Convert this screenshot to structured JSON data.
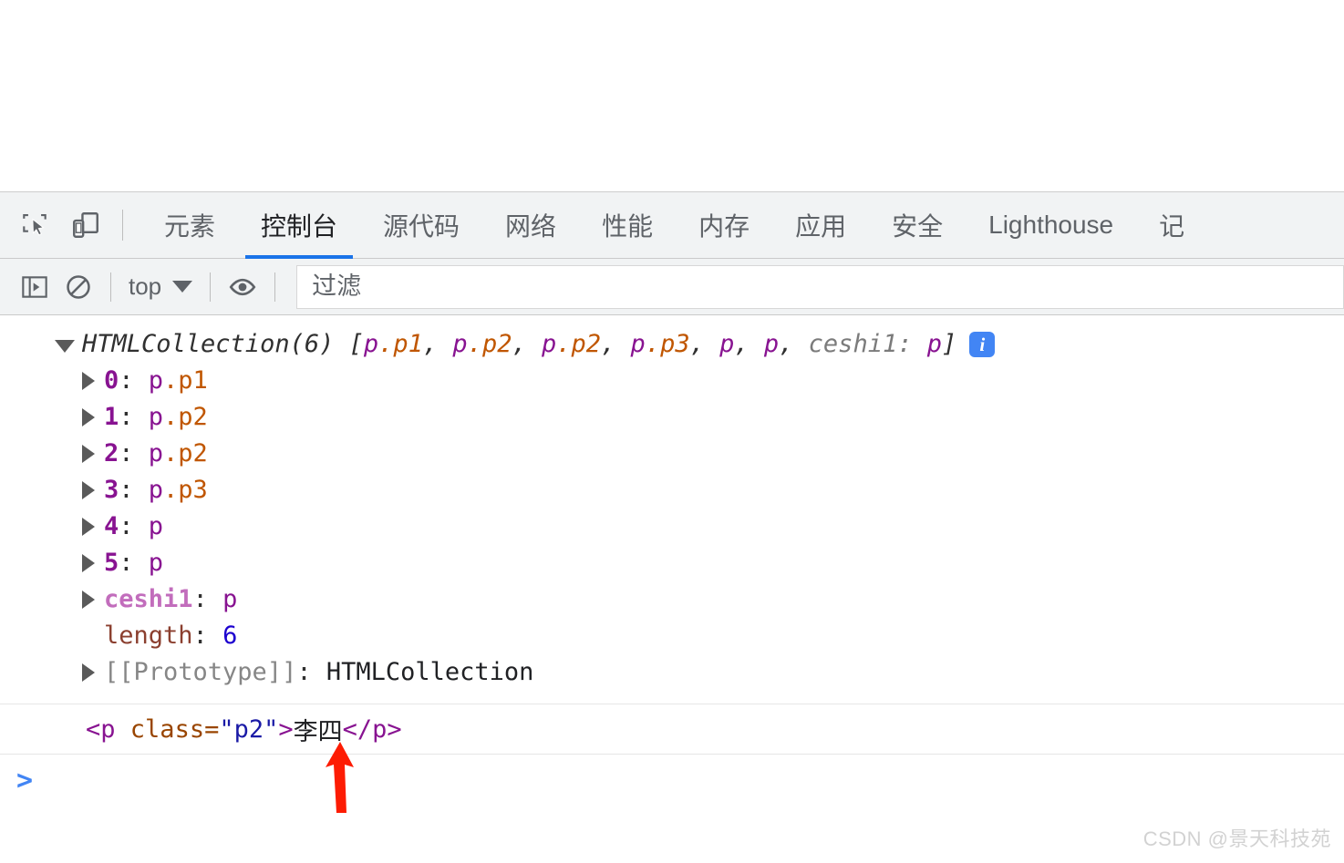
{
  "devtools": {
    "toolbar_icons": [
      {
        "name": "inspect-element-icon",
        "label": "检查元素"
      },
      {
        "name": "device-toolbar-icon",
        "label": "切换设备工具栏"
      }
    ],
    "tabs": [
      {
        "label": "元素",
        "active": false
      },
      {
        "label": "控制台",
        "active": true
      },
      {
        "label": "源代码",
        "active": false
      },
      {
        "label": "网络",
        "active": false
      },
      {
        "label": "性能",
        "active": false
      },
      {
        "label": "内存",
        "active": false
      },
      {
        "label": "应用",
        "active": false
      },
      {
        "label": "安全",
        "active": false
      },
      {
        "label": "Lighthouse",
        "active": false
      },
      {
        "label": "记",
        "active": false
      }
    ],
    "filterbar": {
      "sidebar_toggle": "console-sidebar-icon",
      "clear_console": "clear-console-icon",
      "context_value": "top",
      "eye_icon": "live-expression-icon",
      "filter_placeholder": "过滤",
      "filter_value": ""
    }
  },
  "console": {
    "header": {
      "constructor": "HTMLCollection(6)",
      "bracket_open": " [",
      "preview_items": [
        "p.p1",
        "p.p2",
        "p.p2",
        "p.p3",
        "p",
        "p"
      ],
      "named_key": "ceshi1",
      "named_value": "p",
      "bracket_close": "]",
      "info_badge": "i"
    },
    "entries": [
      {
        "key": "0",
        "key_type": "index",
        "tag": "p",
        "cls": ".p1",
        "expandable": true
      },
      {
        "key": "1",
        "key_type": "index",
        "tag": "p",
        "cls": ".p2",
        "expandable": true
      },
      {
        "key": "2",
        "key_type": "index",
        "tag": "p",
        "cls": ".p2",
        "expandable": true
      },
      {
        "key": "3",
        "key_type": "index",
        "tag": "p",
        "cls": ".p3",
        "expandable": true
      },
      {
        "key": "4",
        "key_type": "index",
        "tag": "p",
        "cls": "",
        "expandable": true
      },
      {
        "key": "5",
        "key_type": "index",
        "tag": "p",
        "cls": "",
        "expandable": true
      },
      {
        "key": "ceshi1",
        "key_type": "name",
        "tag": "p",
        "cls": "",
        "expandable": true
      },
      {
        "key": "length",
        "key_type": "prop",
        "value": "6",
        "value_type": "number",
        "expandable": false
      },
      {
        "key": "[[Prototype]]",
        "key_type": "proto",
        "value": "HTMLCollection",
        "value_type": "object",
        "expandable": true
      }
    ],
    "result": {
      "open_lt": "<",
      "tag": "p",
      "space": " ",
      "attr_name": "class",
      "equals": "=",
      "attr_value": "\"p2\"",
      "open_gt": ">",
      "text": "李四",
      "close": "</p>"
    },
    "prompt_symbol": ">"
  },
  "annotation": {
    "arrow_color": "#fd1c03",
    "arrow_name": "red-pointer-arrow"
  },
  "watermark": {
    "text": "CSDN @景天科技苑"
  },
  "colors": {
    "accent_blue": "#1a73e8",
    "tag_purple": "#881391",
    "class_orange": "#c05600",
    "number_blue": "#1c00cf",
    "toolbar_bg": "#f1f3f4"
  }
}
